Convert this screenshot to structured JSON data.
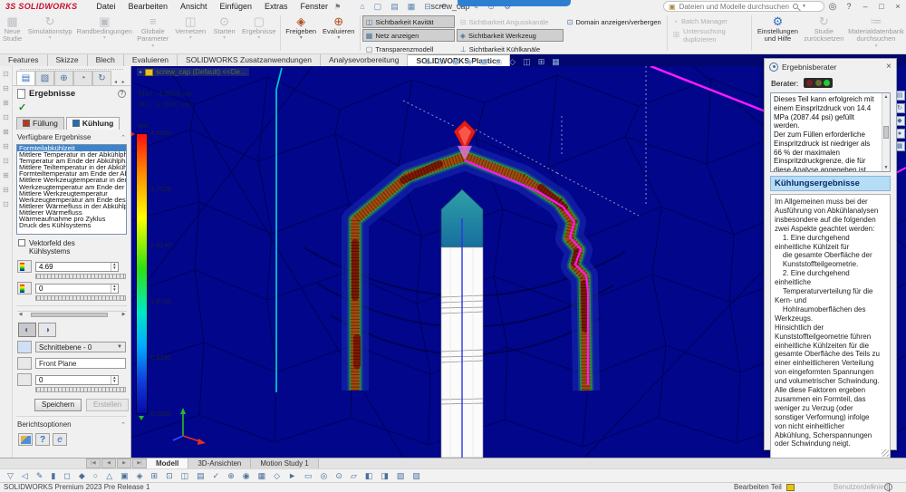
{
  "colors": {
    "accent": "#2f7fd0",
    "viewport_bg": "#01068b",
    "magenta": "#ff1aff",
    "selection": "#3f83c9"
  },
  "titlebar": {
    "brand": "3S SOLIDWORKS",
    "menus": [
      "Datei",
      "Bearbeiten",
      "Ansicht",
      "Einfügen",
      "Extras",
      "Fenster"
    ],
    "quick_icons": [
      "⌂",
      "▢",
      "▤",
      "▦",
      "⊟",
      "↶",
      "↷",
      "✎",
      "⊙",
      "⚙"
    ],
    "document_title": "screw_cap *",
    "search_placeholder": "Dateien und Modelle durchsuchen",
    "minimize": "–",
    "restore": "□",
    "close": "×"
  },
  "ribbon": {
    "buttons": [
      {
        "label": "Neue Studie"
      },
      {
        "label": "Simulationstyp"
      },
      {
        "label": "Randbedingungen"
      },
      {
        "label": "Globale Parameter"
      },
      {
        "label": "Vernetzen"
      },
      {
        "label": "Starten"
      },
      {
        "label": "Ergebnisse"
      },
      {
        "label": "Freigeben"
      },
      {
        "label": "Evaluieren"
      }
    ],
    "toggles": {
      "kavitaet": "Sichtbarkeit Kavität",
      "angusskanaele": "Sichtbarkeit Angusskanäle",
      "netz": "Netz anzeigen",
      "werkzeug": "Sichtbarkeit Werkzeug",
      "transparenz": "Transparenzmodell",
      "kuehlkanaele": "Sichtbarkeit Kühlkanäle",
      "domain": "Domain anzeigen/verbergen"
    },
    "right": {
      "batch": "Batch Manager",
      "duplizieren": "Untersuchung duplizieren",
      "einstellungen": "Einstellungen und Hilfe",
      "zuruecksetzen": "Studie zurücksetzen",
      "material": "Materialdatenbank durchsuchen"
    }
  },
  "command_tabs": [
    "Features",
    "Skizze",
    "Blech",
    "Evaluieren",
    "SOLIDWORKS Zusatzanwendungen",
    "Analysevorbereitung",
    "SOLIDWORKS Plastics"
  ],
  "panel": {
    "title": "Ergebnisse",
    "tab_fuellung": "Füllung",
    "tab_kuehlung": "Kühlung",
    "available_label": "Verfügbare Ergebnisse",
    "results": [
      "Formteilabkühlzeit",
      "Mittlere Temperatur in der Abkühlphase",
      "Temperatur am Ende der Abkühlphase",
      "Mittlere Teiltemperatur in der Abkühlphase",
      "Formteiltemperatur am Ende der Abkühlphase",
      "Mittlere Werkzeugtemperatur in der Abkühlphase",
      "Werkzeugtemperatur am Ende der Abkühlphase",
      "Mittlere Werkzeugtemperatur",
      "Werkzeugtemperatur am Ende des Zyklus",
      "Mittlerer Wärmefluss in der Abkühlphase",
      "Mittlerer Wärmefluss",
      "Wärmeaufnahme pro Zyklus",
      "Druck des Kühlsystems"
    ],
    "vector_label": "Vektorfeld des Kühlsystems",
    "max_value": "4.69",
    "min_value": "0",
    "schnitt": {
      "label": "Schnittebene",
      "plane": "Schnittebene - 0",
      "reference": "Front Plane",
      "offset": "0",
      "save": "Speichern",
      "create": "Erstellen"
    },
    "report_label": "Berichtsoptionen"
  },
  "viewport": {
    "tree_label": "screw_cap (Default) <<De...",
    "max_label": "Max : 4.6900 sec",
    "min_label": "Min : 0.0000 sec",
    "legend": {
      "unit": "sec",
      "ticks": [
        "4.6900",
        "3.7520",
        "2.8140",
        "1.8760",
        "0.9380",
        "0.0000"
      ],
      "colors_top_to_bottom": [
        "#ff0000",
        "#ff8800",
        "#ffff00",
        "#30e010",
        "#00e8c8",
        "#00aaff",
        "#0808a8"
      ]
    },
    "headsup_icons": [
      "⊕",
      "⊡",
      "◉",
      "◈",
      "▣",
      "◎",
      "◇",
      "◫",
      "⊞",
      "▦"
    ],
    "taskpane_icons": [
      "▤",
      "↻",
      "◆",
      "●",
      "▦"
    ]
  },
  "advisor": {
    "title": "Ergebnisberater",
    "berater_label": "Berater:",
    "summary": "Dieses Teil kann erfolgreich mit einem Einspritzdruck von 14.4 MPa (2087.44 psi) gefüllt werden.\nDer zum Füllen erforderliche Einspritzdruck ist niedriger als 66 % der maximalen Einspritzdruckgrenze, die für diese Analyse angegeben ist. Dies bedeutet, dass Sie weit unter der angegebenen Grenze liegen.\nSie können möglicherweise die Teildicke",
    "section_title": "Kühlungsergebnisse",
    "body": "Im Allgemeinen muss bei der Ausführung von Abkühlanalysen insbesondere auf die folgenden zwei Aspekte geachtet werden:\n    1. Eine durchgehend einheitliche Kühlzeit für\n    die gesamte Oberfläche der\n    Kunststoffteilgeometrie.\n    2. Eine durchgehend einheitliche\n    Temperaturverteilung für die Kern- und\n    Hohlraumoberflächen des Werkzeugs.\nHinsichtlich der Kunststoffteilgeometrie führen einheitliche Kühlzeiten für die gesamte Oberfläche des Teils zu einer einheitlicheren Verteilung von eingeformten Spannungen und volumetrischer Schwindung.  Alle diese Faktoren ergeben zusammen ein Formteil, das weniger zu Verzug (oder sonstiger Verformung) infolge von nicht einheitlicher Abkühlung, Scherspannungen oder Schwindung neigt.\n\nWas das Spritzgusswerkzeug selbst betrifft, ist es im Allgemeinen wünschenswert, auf den Oberflächen der Werkzeugkerne und -hohlräume eine einheitliche Temperaturverteilung zu erzielen. Wenn man davon ausgeht, dass das zu formende Teil eine einheitliche Wandstärke hat, fördern einheitliche Temperaturen auf den Werkzeugoberflächen nämlich einheitliche Kühlzeiten auf der gesamten Oberfläche des Teils, sodass das Teil weniger zu Verzug neigt (wie oben beschrieben)."
  },
  "bottom": {
    "tabs": [
      "Modell",
      "3D-Ansichten",
      "Motion Study 1"
    ],
    "left_strip_icons": [
      "⊡",
      "⊟",
      "⊞",
      "⊡",
      "⊠",
      "⊟",
      "⊡",
      "⊞",
      "⊟",
      "⊡"
    ],
    "toolbar_icons": [
      "▽",
      "◁",
      "✎",
      "▮",
      "◻",
      "◆",
      "○",
      "△",
      "▣",
      "◈",
      "⊞",
      "⊡",
      "◫",
      "▤",
      "✓",
      "⊕",
      "◉",
      "▦",
      "◇",
      "►",
      "▭",
      "◎",
      "⊙",
      "▱",
      "◧",
      "◨",
      "▧",
      "▨"
    ],
    "status_left": "SOLIDWORKS Premium 2023 Pre Release 1",
    "status_mode": "Bearbeiten Teil",
    "status_custom": "Benutzerdefiniert"
  }
}
